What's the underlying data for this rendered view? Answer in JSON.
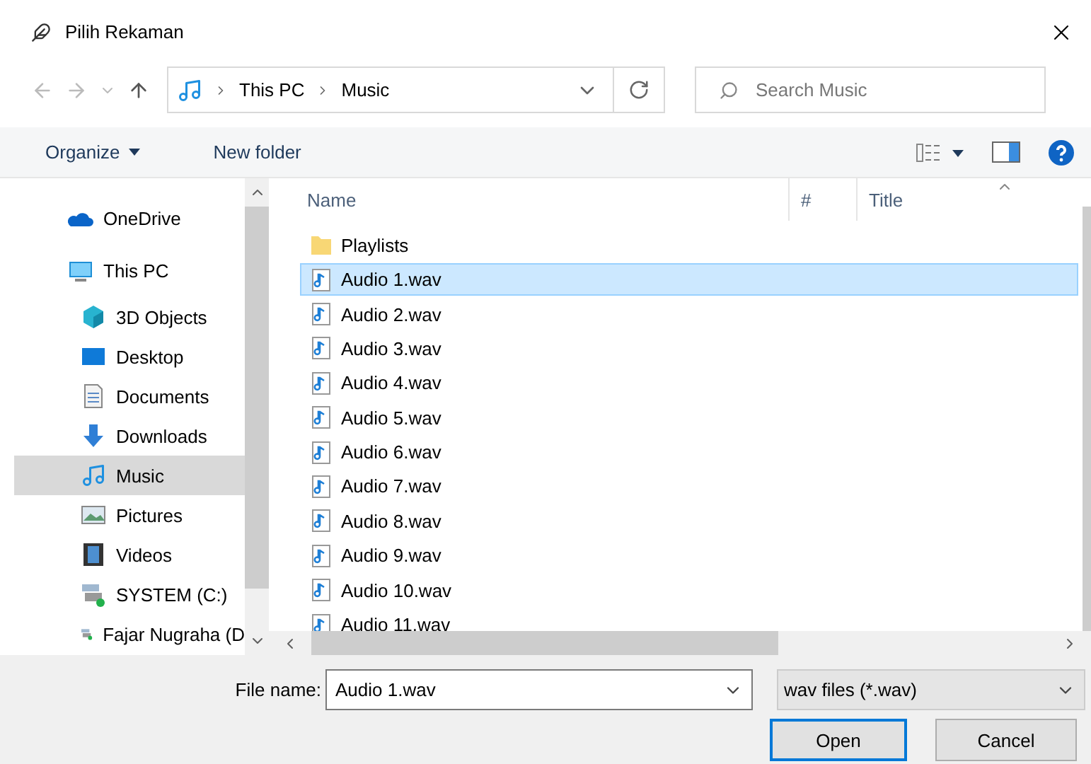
{
  "window": {
    "title": "Pilih Rekaman"
  },
  "address": {
    "path": [
      {
        "label": "This PC"
      },
      {
        "label": "Music"
      }
    ]
  },
  "search": {
    "placeholder": "Search Music"
  },
  "toolbar": {
    "items": [
      {
        "label": "Organize",
        "kind": "menu"
      },
      {
        "label": "New folder",
        "kind": "button"
      }
    ]
  },
  "sidebar": {
    "items": [
      {
        "label": "OneDrive",
        "kind": "cloud",
        "selected": false
      },
      {
        "label": "This PC",
        "kind": "computer",
        "selected": false,
        "children": [
          {
            "label": "3D Objects",
            "kind": "cube",
            "selected": false
          },
          {
            "label": "Desktop",
            "kind": "desktop",
            "selected": false
          },
          {
            "label": "Documents",
            "kind": "document",
            "selected": false
          },
          {
            "label": "Downloads",
            "kind": "download",
            "selected": false
          },
          {
            "label": "Music",
            "kind": "music",
            "selected": true
          },
          {
            "label": "Pictures",
            "kind": "picture",
            "selected": false
          },
          {
            "label": "Videos",
            "kind": "video",
            "selected": false
          },
          {
            "label": "SYSTEM (C:)",
            "kind": "drive",
            "selected": false
          },
          {
            "label": "Fajar Nugraha (D",
            "kind": "drive",
            "selected": false
          }
        ]
      }
    ]
  },
  "table": {
    "columns": [
      {
        "label": "Name"
      },
      {
        "label": "#"
      },
      {
        "label": "Title"
      }
    ],
    "rows": [
      {
        "name": "Playlists",
        "kind": "folder",
        "selected": false
      },
      {
        "name": "Audio 1.wav",
        "kind": "audio",
        "selected": true
      },
      {
        "name": "Audio 2.wav",
        "kind": "audio",
        "selected": false
      },
      {
        "name": "Audio 3.wav",
        "kind": "audio",
        "selected": false
      },
      {
        "name": "Audio 4.wav",
        "kind": "audio",
        "selected": false
      },
      {
        "name": "Audio 5.wav",
        "kind": "audio",
        "selected": false
      },
      {
        "name": "Audio 6.wav",
        "kind": "audio",
        "selected": false
      },
      {
        "name": "Audio 7.wav",
        "kind": "audio",
        "selected": false
      },
      {
        "name": "Audio 8.wav",
        "kind": "audio",
        "selected": false
      },
      {
        "name": "Audio 9.wav",
        "kind": "audio",
        "selected": false
      },
      {
        "name": "Audio 10.wav",
        "kind": "audio",
        "selected": false
      },
      {
        "name": "Audio 11.wav",
        "kind": "audio",
        "selected": false
      }
    ]
  },
  "footer": {
    "file_name_label": "File name:",
    "file_name": "Audio 1.wav",
    "file_type": "wav files (*.wav)",
    "buttons": [
      {
        "label": "Open",
        "kind": "primary"
      },
      {
        "label": "Cancel",
        "kind": "secondary"
      }
    ]
  }
}
